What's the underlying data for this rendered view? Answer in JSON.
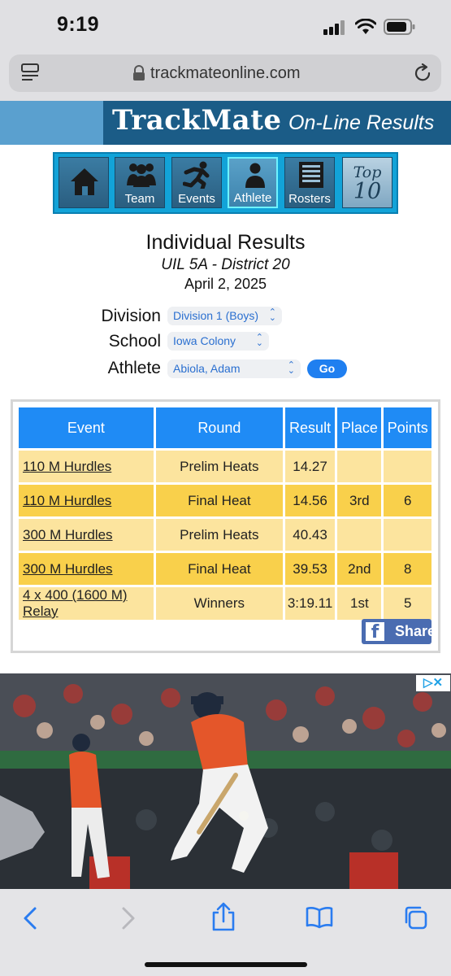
{
  "status_bar": {
    "time": "9:19"
  },
  "browser": {
    "url": "trackmateonline.com"
  },
  "banner": {
    "brand": "TrackMate",
    "subtitle": "On-Line Results"
  },
  "nav": {
    "items": [
      {
        "label": ""
      },
      {
        "label": "Team"
      },
      {
        "label": "Events"
      },
      {
        "label": "Athlete"
      },
      {
        "label": "Rosters"
      }
    ],
    "top10": {
      "line1": "Top",
      "line2": "10"
    }
  },
  "page": {
    "title": "Individual Results",
    "meet": "UIL 5A - District 20",
    "date": "April 2, 2025"
  },
  "filters": {
    "division_label": "Division",
    "division_value": "Division 1 (Boys)",
    "school_label": "School",
    "school_value": "Iowa Colony",
    "athlete_label": "Athlete",
    "athlete_value": "Abiola, Adam",
    "go_label": "Go"
  },
  "table": {
    "headers": [
      "Event",
      "Round",
      "Result",
      "Place",
      "Points"
    ],
    "rows": [
      {
        "event": "110 M Hurdles",
        "round": "Prelim Heats",
        "result": "14.27",
        "place": "",
        "points": ""
      },
      {
        "event": "110 M Hurdles",
        "round": "Final Heat",
        "result": "14.56",
        "place": "3rd",
        "points": "6"
      },
      {
        "event": "300 M Hurdles",
        "round": "Prelim Heats",
        "result": "40.43",
        "place": "",
        "points": ""
      },
      {
        "event": "300 M Hurdles",
        "round": "Final Heat",
        "result": "39.53",
        "place": "2nd",
        "points": "8"
      },
      {
        "event": "4 x 400 (1600 M) Relay",
        "round": "Winners",
        "result": "3:19.11",
        "place": "1st",
        "points": "5"
      }
    ]
  },
  "share": {
    "label": "Share",
    "icon": "f"
  },
  "ad": {
    "badge": "▷✕"
  },
  "colors": {
    "banner_dark": "#1b5c87",
    "nav_bg": "#12a3d8",
    "header_blue": "#1f8bf5",
    "row_light": "#fce49e",
    "row_dark": "#f9d04b",
    "go_blue": "#1f7ff0",
    "facebook": "#4a6cb1"
  }
}
